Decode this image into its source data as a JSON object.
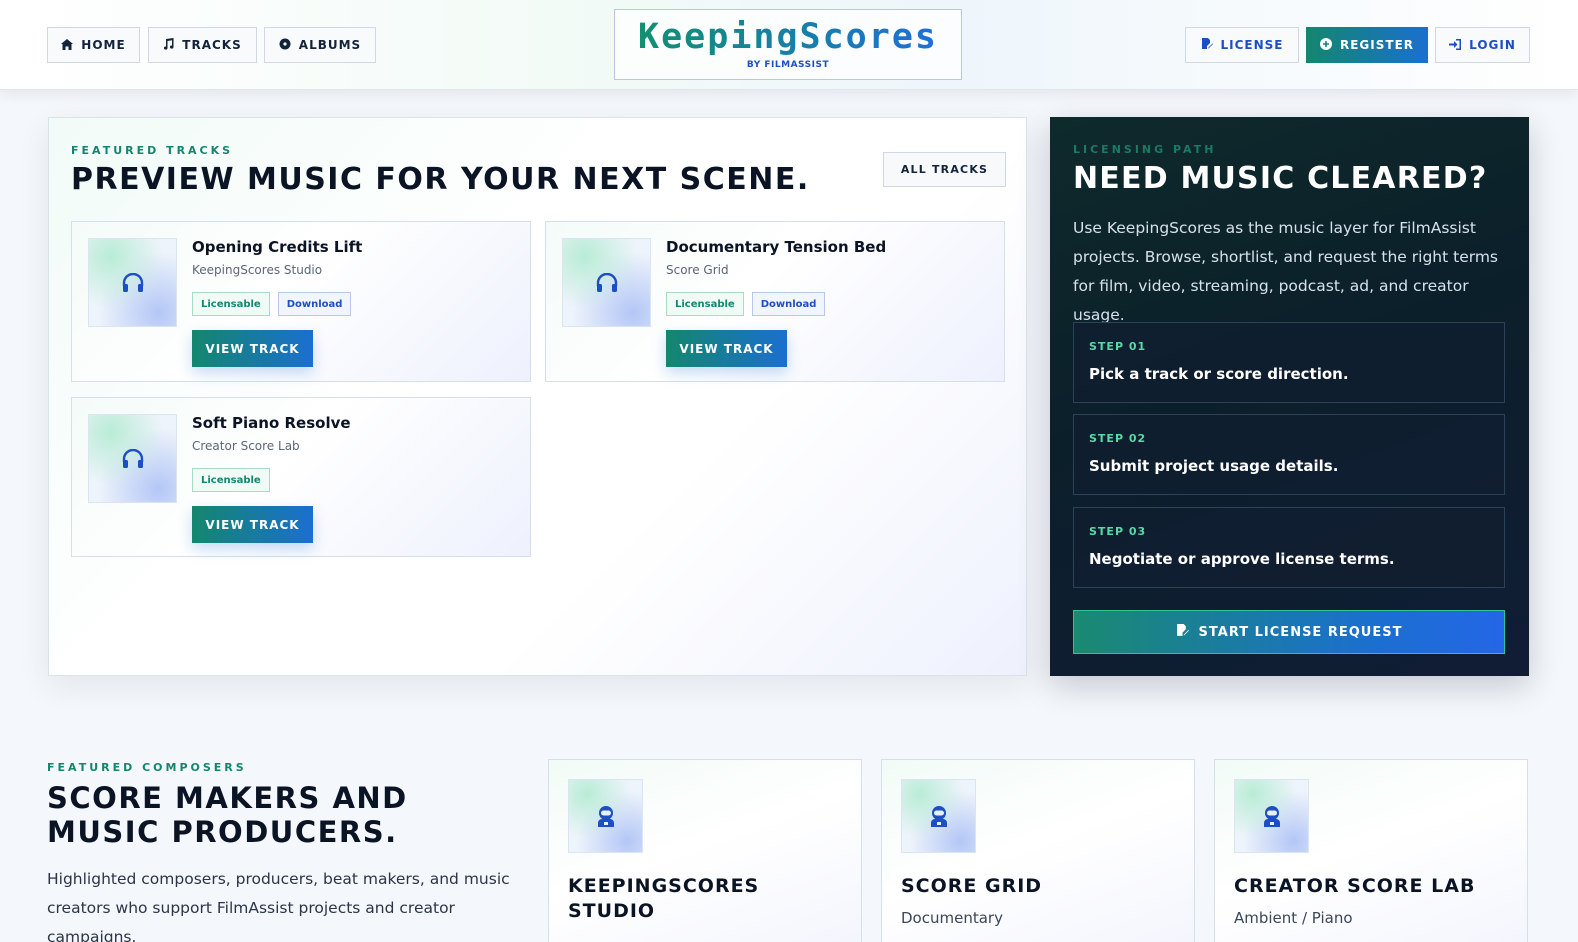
{
  "header": {
    "nav_left": [
      {
        "label": "HOME",
        "icon": "home-icon"
      },
      {
        "label": "TRACKS",
        "icon": "music-note-icon"
      },
      {
        "label": "ALBUMS",
        "icon": "disc-icon"
      }
    ],
    "logo": {
      "title": "KeepingScores",
      "subtitle": "BY FILMASSIST"
    },
    "nav_right": [
      {
        "label": "LICENSE",
        "icon": "edit-document-icon"
      },
      {
        "label": "REGISTER",
        "icon": "plus-circle-icon"
      },
      {
        "label": "LOGIN",
        "icon": "sign-in-icon"
      }
    ]
  },
  "featured_tracks": {
    "eyebrow": "FEATURED TRACKS",
    "title": "PREVIEW MUSIC FOR YOUR NEXT SCENE.",
    "all_tracks_label": "ALL TRACKS",
    "tracks": [
      {
        "title": "Opening Credits Lift",
        "artist": "KeepingScores Studio",
        "badges": [
          "Licensable",
          "Download"
        ],
        "button": "VIEW TRACK"
      },
      {
        "title": "Documentary Tension Bed",
        "artist": "Score Grid",
        "badges": [
          "Licensable",
          "Download"
        ],
        "button": "VIEW TRACK"
      },
      {
        "title": "Soft Piano Resolve",
        "artist": "Creator Score Lab",
        "badges": [
          "Licensable"
        ],
        "button": "VIEW TRACK"
      }
    ]
  },
  "licensing": {
    "eyebrow": "LICENSING PATH",
    "title": "NEED MUSIC CLEARED?",
    "description": "Use KeepingScores as the music layer for FilmAssist projects. Browse, shortlist, and request the right terms for film, video, streaming, podcast, ad, and creator usage.",
    "steps": [
      {
        "label": "STEP 01",
        "text": "Pick a track or score direction."
      },
      {
        "label": "STEP 02",
        "text": "Submit project usage details."
      },
      {
        "label": "STEP 03",
        "text": "Negotiate or approve license terms."
      }
    ],
    "cta_label": "START LICENSE REQUEST"
  },
  "composers": {
    "eyebrow": "FEATURED COMPOSERS",
    "title": "SCORE MAKERS AND MUSIC PRODUCERS.",
    "description": "Highlighted composers, producers, beat makers, and music creators who support FilmAssist projects and creator campaigns.",
    "cards": [
      {
        "name": "KEEPINGSCORES STUDIO",
        "genre": ""
      },
      {
        "name": "SCORE GRID",
        "genre": "Documentary"
      },
      {
        "name": "CREATOR SCORE LAB",
        "genre": "Ambient / Piano"
      }
    ]
  },
  "colors": {
    "accent_green": "#13876e",
    "accent_blue": "#1b6fd0",
    "dark_panel": "#0b1f2a"
  }
}
